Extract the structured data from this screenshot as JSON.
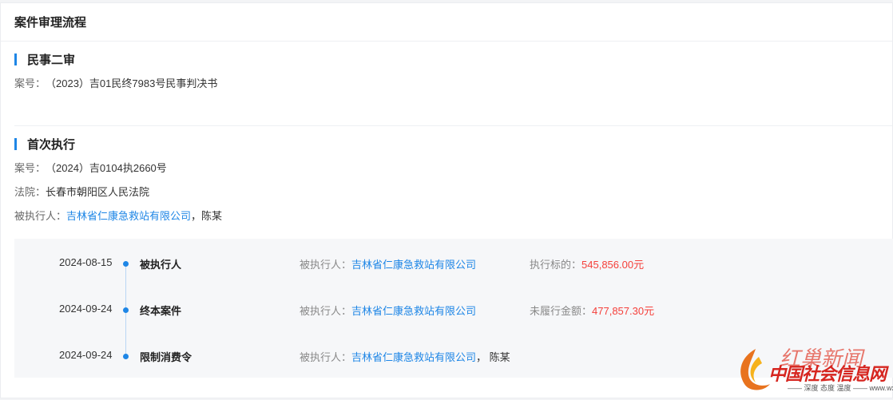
{
  "card": {
    "title": "案件审理流程"
  },
  "second_trial": {
    "title": "民事二审",
    "case_no_label": "案号：",
    "case_no": "（2023）吉01民终7983号民事判决书"
  },
  "first_exec": {
    "title": "首次执行",
    "case_no_label": "案号：",
    "case_no": "（2024）吉0104执2660号",
    "court_label": "法院：",
    "court": "长春市朝阳区人民法院",
    "executed_label": "被执行人：",
    "executed_link": "吉林省仁康急救站有限公司",
    "executed_sep": "，",
    "executed_other": "陈某"
  },
  "timeline": [
    {
      "date": "2024-08-15",
      "event": "被执行人",
      "party_label": "被执行人：",
      "party": "吉林省仁康急救站有限公司",
      "party_extra": "",
      "amount_label": "执行标的：",
      "amount": "545,856.00元"
    },
    {
      "date": "2024-09-24",
      "event": "终本案件",
      "party_label": "被执行人：",
      "party": "吉林省仁康急救站有限公司",
      "party_extra": "",
      "amount_label": "未履行金额：",
      "amount": "477,857.30元"
    },
    {
      "date": "2024-09-24",
      "event": "限制消费令",
      "party_label": "被执行人：",
      "party": "吉林省仁康急救站有限公司",
      "party_extra": "， 陈某",
      "amount_label": "",
      "amount": ""
    }
  ],
  "watermark": {
    "top_text": "红巢新闻",
    "main_text": "中国社会信息网",
    "sub_text": "—— 深度 态度 温度 —— www.wx-cmc.cn"
  },
  "colors": {
    "accent": "#1e86e6",
    "amount": "#f5403b"
  }
}
